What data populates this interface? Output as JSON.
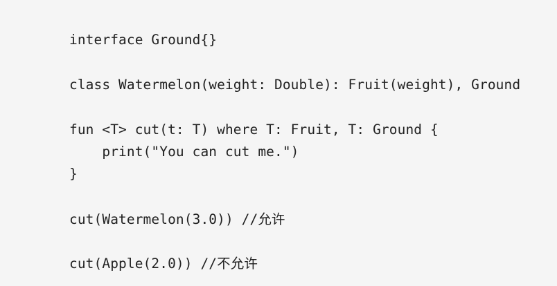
{
  "code": {
    "lines": [
      "interface Ground{}",
      "class Watermelon(weight: Double): Fruit(weight), Ground",
      "fun <T> cut(t: T) where T: Fruit, T: Ground {",
      "    print(\"You can cut me.\")",
      "}",
      "cut(Watermelon(3.0)) //允许",
      "cut(Apple(2.0)) //不允许"
    ]
  }
}
